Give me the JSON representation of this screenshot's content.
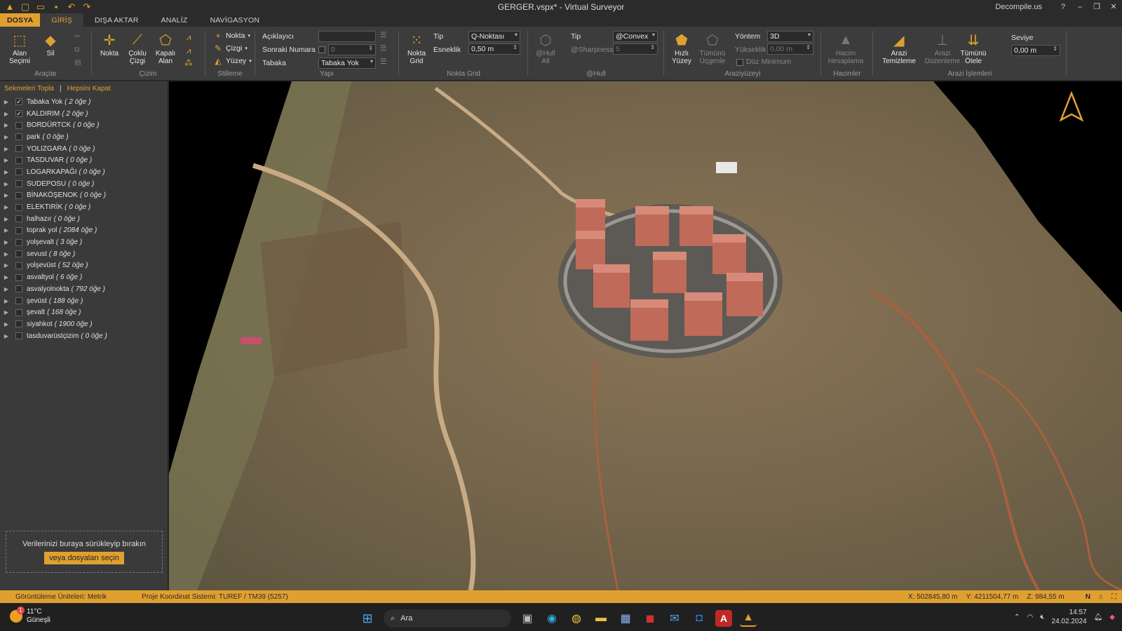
{
  "window": {
    "title": "GERGER.vspx*  -  Virtual Surveyor",
    "account": "Decompile.us",
    "help": "?",
    "minimize": "–",
    "restore": "❐",
    "close": "✕"
  },
  "tabs": [
    "DOSYA",
    "GİRİŞ",
    "DIŞA AKTAR",
    "ANALİZ",
    "NAVİGASYON"
  ],
  "ribbon": {
    "araclar": {
      "label": "Araçlar",
      "alan_secimi": "Alan\nSeçimi",
      "sil": "Sil"
    },
    "cizim": {
      "label": "Çizim",
      "nokta": "Nokta",
      "coklu_cizgi": "Çoklu\nÇizgi",
      "kapali_alan": "Kapalı\nAlan"
    },
    "stilleme": {
      "label": "Stilleme",
      "nokta": "Nokta",
      "cizgi": "Çizgi",
      "yuzey": "Yüzey"
    },
    "yapi": {
      "label": "Yapı",
      "aciklayici": "Açıklayıcı",
      "sonraki_numara": "Sonraki Numara",
      "tabaka": "Tabaka",
      "numara_value": "0",
      "tabaka_value": "Tabaka Yok"
    },
    "nokta_grid": {
      "label": "Nokta Grid",
      "button": "Nokta\nGrid",
      "tip_label": "Tip",
      "tip_value": "Q-Noktası",
      "esneklik_label": "Esneklik",
      "esneklik_value": "0,50 m"
    },
    "hull": {
      "label": "@Hull",
      "hull_all": "@Hull\nAll",
      "tip_label": "Tip",
      "tip_value": "@Convex",
      "sharpness_label": "@Sharpness",
      "sharpness_value": "5"
    },
    "arazi_yuzeyi": {
      "label": "Araziyüzeyi",
      "hizli_yuzey": "Hızlı\nYüzey",
      "tumunu_ucgenle": "Tümünü\nÜçgenle",
      "yontem_label": "Yöntem",
      "yontem_value": "3D",
      "yukseklik_label": "Yükseklik",
      "yukseklik_value": "0,00 m",
      "duz_minimum": "Düz Minimum"
    },
    "hacimler": {
      "label": "Hacimler",
      "hacim_hesaplama": "Hacim\nHesaplama"
    },
    "arazi_islemleri": {
      "label": "Arazi İşlemleri",
      "arazi_temizleme": "Arazi\nTemizleme",
      "arazi_duzenleme": "Arazi\nDüzenleme",
      "tumunu_otele": "Tümünü\nÖtele",
      "seviye_label": "Seviye",
      "seviye_value": "0,00 m"
    }
  },
  "sidebar": {
    "collapse_all": "Sekmeleri Topla",
    "separator": "|",
    "close_all": "Hepsini Kapat",
    "layers": [
      {
        "name": "Tabaka Yok",
        "count": "( 2 öğe )",
        "checked": true
      },
      {
        "name": "KALDIRIM",
        "count": "( 2 öğe )",
        "checked": true
      },
      {
        "name": "BORDÜRTCK",
        "count": "( 0 öğe )",
        "checked": false
      },
      {
        "name": "park",
        "count": "( 0 öğe )",
        "checked": false
      },
      {
        "name": "YOLIZGARA",
        "count": "( 0 öğe )",
        "checked": false
      },
      {
        "name": "TASDUVAR",
        "count": "( 0 öğe )",
        "checked": false
      },
      {
        "name": "LOGARKAPAĞI",
        "count": "( 0 öğe )",
        "checked": false
      },
      {
        "name": "SUDEPOSU",
        "count": "( 0 öğe )",
        "checked": false
      },
      {
        "name": "BİNAKÖŞENOK",
        "count": "( 0 öğe )",
        "checked": false
      },
      {
        "name": "ELEKTIRİK",
        "count": "( 0 öğe )",
        "checked": false
      },
      {
        "name": "halhazır",
        "count": "( 0 öğe )",
        "checked": false
      },
      {
        "name": "toprak yol",
        "count": "( 2084 öğe )",
        "checked": false
      },
      {
        "name": "yolşevalt",
        "count": "( 3 öğe )",
        "checked": false
      },
      {
        "name": "sevust",
        "count": "( 8 öğe )",
        "checked": false
      },
      {
        "name": "yolşevüst",
        "count": "( 52 öğe )",
        "checked": false
      },
      {
        "name": "asvaltyol",
        "count": "( 6 öğe )",
        "checked": false
      },
      {
        "name": "asvalyolnokta",
        "count": "( 792 öğe )",
        "checked": false
      },
      {
        "name": "şevüst",
        "count": "( 188 öğe )",
        "checked": false
      },
      {
        "name": "şevalt",
        "count": "( 168 öğe )",
        "checked": false
      },
      {
        "name": "siyahkot",
        "count": "( 1900 öğe )",
        "checked": false
      },
      {
        "name": "tasduvarüstçizim",
        "count": "( 0 öğe )",
        "checked": false
      }
    ],
    "drop_text": "Verilerinizi buraya sürükleyip bırakın",
    "drop_button": "veya dosyaları seçin"
  },
  "status": {
    "units": "Görüntüleme Üniteleri: Metrik",
    "crs": "Proje Koordinat Sistemi:  TUREF / TM39 (5257)",
    "x": "X: 502845,80 m",
    "y": "Y: 4211504,77 m",
    "z": "Z: 984,55 m",
    "north": "N"
  },
  "taskbar": {
    "temp": "11°C",
    "weather": "Güneşli",
    "badge": "1",
    "search": "Ara",
    "time": "14:57",
    "date": "24.02.2024"
  },
  "colors": {
    "accent": "#e0a030",
    "panel": "#3a3a3a",
    "ribbon": "#3c3c3c"
  }
}
